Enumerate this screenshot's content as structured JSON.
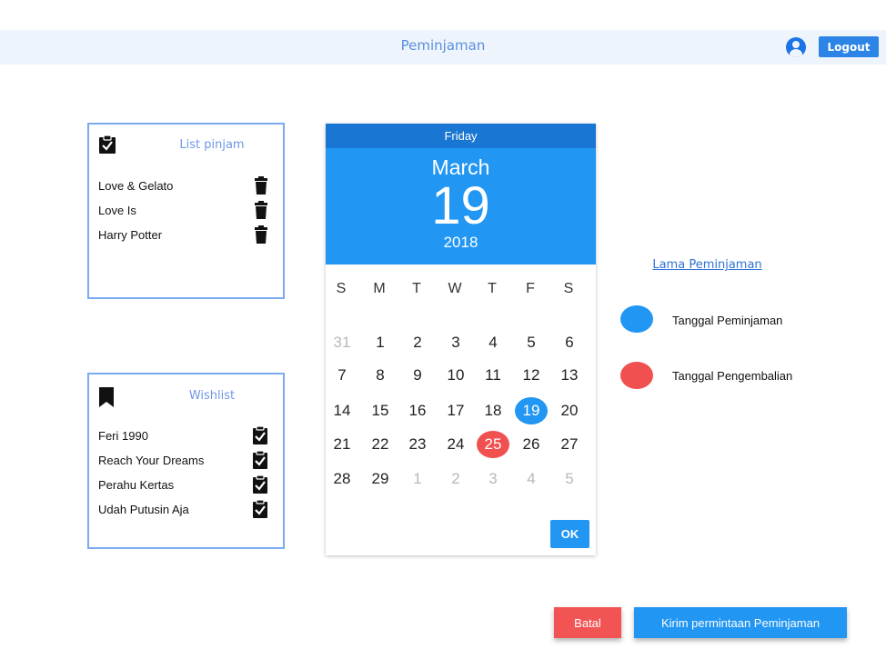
{
  "header": {
    "title": "Peminjaman",
    "logout_label": "Logout"
  },
  "list_pinjam": {
    "title": "List pinjam",
    "items": [
      "Love & Gelato",
      "Love Is",
      "Harry Potter"
    ]
  },
  "wishlist": {
    "title": "Wishlist",
    "items": [
      "Feri 1990",
      "Reach Your Dreams",
      "Perahu Kertas",
      "Udah Putusin Aja"
    ]
  },
  "calendar": {
    "weekday": "Friday",
    "month": "March",
    "day": "19",
    "year": "2018",
    "week_headers": [
      "S",
      "M",
      "T",
      "W",
      "T",
      "F",
      "S"
    ],
    "weeks": [
      [
        "31",
        "1",
        "2",
        "3",
        "4",
        "5",
        "6"
      ],
      [
        "7",
        "8",
        "9",
        "10",
        "11",
        "12",
        "13"
      ],
      [
        "14",
        "15",
        "16",
        "17",
        "18",
        "19",
        "20"
      ],
      [
        "21",
        "22",
        "23",
        "24",
        "25",
        "26",
        "27"
      ],
      [
        "28",
        "29",
        "1",
        "2",
        "3",
        "4",
        "5"
      ]
    ],
    "selected_day": "19",
    "return_day": "25",
    "ok_label": "OK",
    "selected_color": "#2196f3",
    "return_color": "#f05050"
  },
  "legend": {
    "title": "Lama Peminjaman",
    "borrow_label": "Tanggal Peminjaman",
    "return_label": "Tanggal Pengembalian",
    "borrow_color": "#2196f3",
    "return_color": "#f05050"
  },
  "actions": {
    "cancel_label": "Batal",
    "submit_label": "Kirim permintaan Peminjaman"
  },
  "icons": {
    "list_header": "clipboard-check-icon",
    "item_action": "trash-icon",
    "wishlist_header": "bookmark-icon",
    "wishlist_item": "clipboard-check-icon",
    "user": "user-circle-icon"
  }
}
